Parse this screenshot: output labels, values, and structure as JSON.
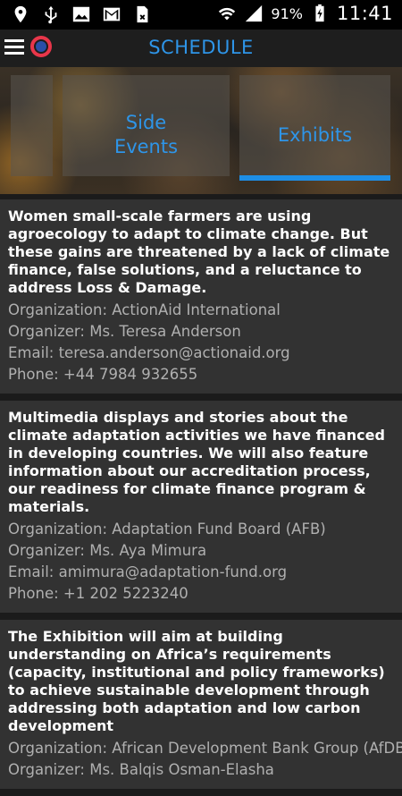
{
  "status_bar": {
    "battery_percent": "91%",
    "time": "11:41"
  },
  "app_bar": {
    "title": "SCHEDULE"
  },
  "tabs": [
    {
      "label": "Side\nEvents",
      "selected": false
    },
    {
      "label": "Exhibits",
      "selected": true
    }
  ],
  "colors": {
    "accent": "#2e95e8",
    "card_bg": "#323232",
    "screen_bg": "#1b1b1b"
  },
  "exhibits": [
    {
      "description": "Women small-scale farmers are using agroecology to adapt to climate change. But these gains are threatened by a lack of climate finance, false solutions, and a reluctance to address Loss & Damage.",
      "organization": "Organization: ActionAid International",
      "organizer": "Organizer: Ms. Teresa Anderson",
      "email": "Email: teresa.anderson@actionaid.org",
      "phone": "Phone: +44 7984 932655"
    },
    {
      "description": "Multimedia displays and stories about the climate adaptation activities we have financed in developing countries. We will also feature information about our accreditation process, our readiness for climate finance program & materials.",
      "organization": "Organization: Adaptation Fund Board (AFB)",
      "organizer": "Organizer: Ms. Aya Mimura",
      "email": "Email: amimura@adaptation-fund.org",
      "phone": "Phone: +1 202 5223240"
    },
    {
      "description": "The Exhibition will aim at building understanding on Africa’s requirements (capacity, institutional and policy frameworks) to achieve sustainable development  through addressing both adaptation and low carbon development",
      "organization": "Organization: African Development Bank Group (AfDB)",
      "organizer": "Organizer: Ms. Balqis Osman-Elasha"
    }
  ]
}
